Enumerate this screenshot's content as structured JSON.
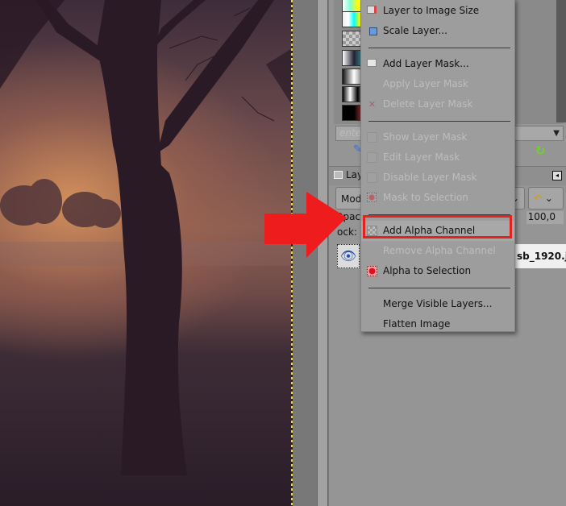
{
  "panel": {
    "search_placeholder": "enter",
    "layers_tab_label": "Lay",
    "mode_label": "Mod",
    "opacity_label": "Opac",
    "opacity_value": "100,0",
    "lock_label": "ock:",
    "layer_name": "sb_1920.jp"
  },
  "menu": {
    "items": [
      {
        "label": "Layer to Image Size",
        "enabled": true,
        "icon": "layer-to-image-size-icon"
      },
      {
        "label": "Scale Layer...",
        "enabled": true,
        "icon": "scale-layer-icon"
      },
      {
        "label": "Add Layer Mask...",
        "enabled": true,
        "icon": "add-layer-mask-icon"
      },
      {
        "label": "Apply Layer Mask",
        "enabled": false,
        "icon": ""
      },
      {
        "label": "Delete Layer Mask",
        "enabled": false,
        "icon": "delete-x-icon"
      },
      {
        "label": "Show Layer Mask",
        "enabled": false,
        "icon": "checkbox-icon"
      },
      {
        "label": "Edit Layer Mask",
        "enabled": false,
        "icon": "checkbox-icon"
      },
      {
        "label": "Disable Layer Mask",
        "enabled": false,
        "icon": "checkbox-icon"
      },
      {
        "label": "Mask to Selection",
        "enabled": false,
        "icon": "mask-to-selection-icon"
      },
      {
        "label": "Add Alpha Channel",
        "enabled": true,
        "highlighted": true,
        "icon": "transparency-icon"
      },
      {
        "label": "Remove Alpha Channel",
        "enabled": false,
        "icon": ""
      },
      {
        "label": "Alpha to Selection",
        "enabled": true,
        "icon": "alpha-to-selection-icon"
      },
      {
        "label": "Merge Visible Layers...",
        "enabled": true,
        "icon": ""
      },
      {
        "label": "Flatten Image",
        "enabled": true,
        "icon": ""
      }
    ]
  },
  "colors": {
    "highlight": "#e8201e",
    "arrow": "#ee1c1c",
    "menu_bg": "#9d9d9d"
  }
}
